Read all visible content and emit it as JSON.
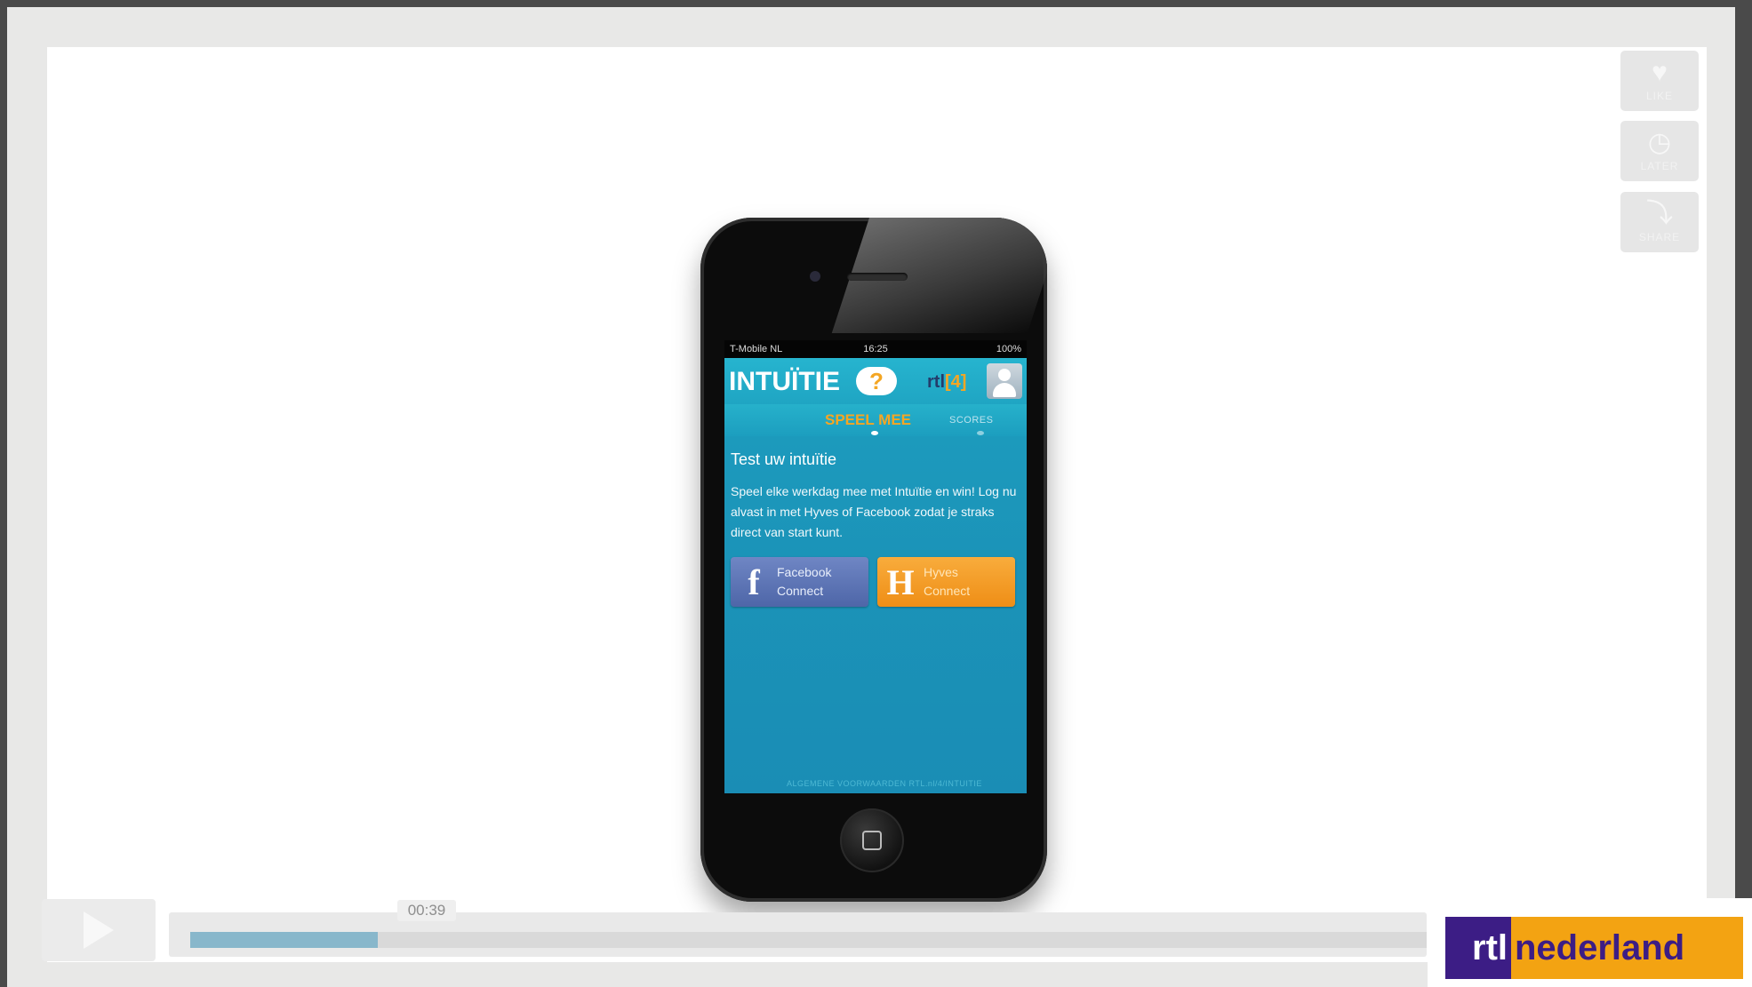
{
  "side_actions": [
    {
      "label": "LIKE",
      "icon": "heart-icon"
    },
    {
      "label": "LATER",
      "icon": "clock-icon"
    },
    {
      "label": "SHARE",
      "icon": "share-icon"
    }
  ],
  "phone": {
    "status": {
      "carrier": "T-Mobile NL",
      "time": "16:25",
      "battery": "100%"
    },
    "app": {
      "logo_text": "INTUÏTIE",
      "logo_bubble": "?",
      "channel": "rtl",
      "channel_bracket": "[4]",
      "tabs": {
        "active": "SPEEL MEE",
        "other": "SCORES"
      },
      "heading": "Test uw intuïtie",
      "paragraph": "Speel elke werkdag mee met Intuïtie en win! Log nu alvast in met Hyves of Facebook zodat je straks direct van start kunt.",
      "buttons": {
        "facebook": {
          "glyph": "f",
          "line1": "Facebook",
          "line2": "Connect"
        },
        "hyves": {
          "glyph": "H",
          "line1": "Hyves",
          "line2": "Connect"
        }
      },
      "footer": "ALGEMENE VOORWAARDEN    RTL.nl/4/INTUITIE"
    }
  },
  "player": {
    "time": "00:39",
    "progress": 0.152
  },
  "brand": {
    "part1": "rtl",
    "part2": "nederland"
  }
}
